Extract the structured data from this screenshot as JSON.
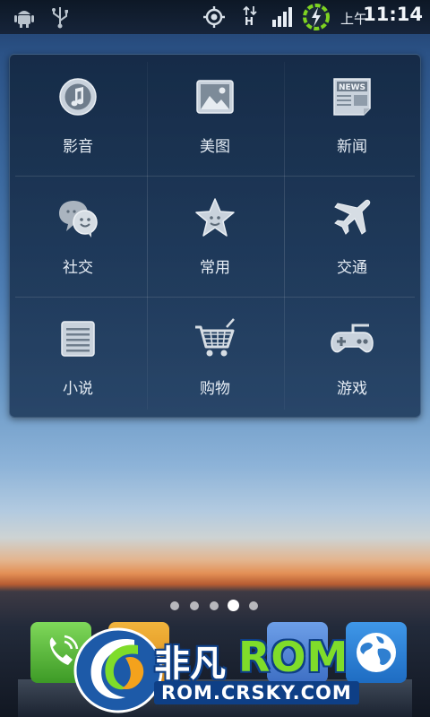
{
  "status_bar": {
    "time": "11:14",
    "am_pm": "上午",
    "network_type": "H",
    "icons": [
      "android-debug-icon",
      "usb-icon",
      "gps-icon",
      "data-transfer-icon",
      "signal-icon",
      "charging-ring-icon"
    ]
  },
  "folder": {
    "apps": [
      {
        "label": "影音",
        "icon": "music-icon"
      },
      {
        "label": "美图",
        "icon": "picture-icon"
      },
      {
        "label": "新闻",
        "icon": "news-icon",
        "icon_text": "NEWS"
      },
      {
        "label": "社交",
        "icon": "chat-bubbles-icon"
      },
      {
        "label": "常用",
        "icon": "star-icon"
      },
      {
        "label": "交通",
        "icon": "airplane-icon"
      },
      {
        "label": "小说",
        "icon": "book-icon"
      },
      {
        "label": "购物",
        "icon": "shopping-cart-icon"
      },
      {
        "label": "游戏",
        "icon": "gamepad-icon"
      }
    ]
  },
  "pager": {
    "total_pages": 5,
    "current_page": 4
  },
  "dock": {
    "icons": [
      "phone-icon",
      "contacts-icon",
      "messages-icon",
      "browser-globe-icon"
    ]
  },
  "watermark": {
    "brand": "非凡",
    "rom": "ROM",
    "url": "ROM.CRSKY.COM"
  },
  "colors": {
    "status_bar": "#0d1826",
    "folder_bg": "#1c3454",
    "icon_silver": "#c9d2dc",
    "label": "#e6edf5",
    "dock_phone": "#4fb534",
    "watermark_green": "#7fdc2a"
  }
}
